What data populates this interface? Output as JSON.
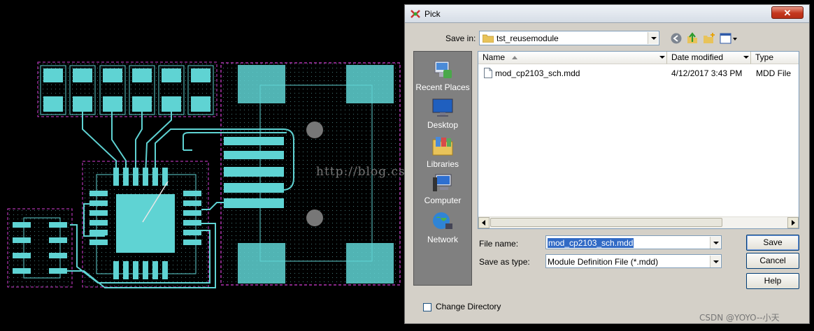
{
  "background": {
    "watermark": "http://blog.csdn.net/tgface",
    "csdn_mark": "CSDN @YOYO--小天",
    "board_color": "#5fd3d3",
    "outline_color": "#d63fd6"
  },
  "dialog": {
    "title": "Pick",
    "close_icon": "close-icon",
    "save_in_label": "Save in:",
    "save_in_value": "tst_reusemodule",
    "places": [
      {
        "label": "Recent Places",
        "icon": "recent-places-icon"
      },
      {
        "label": "Desktop",
        "icon": "desktop-icon"
      },
      {
        "label": "Libraries",
        "icon": "libraries-icon"
      },
      {
        "label": "Computer",
        "icon": "computer-icon"
      },
      {
        "label": "Network",
        "icon": "network-icon"
      }
    ],
    "columns": [
      "Name",
      "Date modified",
      "Type"
    ],
    "files": [
      {
        "name": "mod_cp2103_sch.mdd",
        "date": "4/12/2017 3:43 PM",
        "type": "MDD File"
      }
    ],
    "file_name_label": "File name:",
    "file_name_value": "mod_cp2103_sch.mdd",
    "save_as_type_label": "Save as type:",
    "save_as_type_value": "Module Definition File (*.mdd)",
    "save_button": "Save",
    "cancel_button": "Cancel",
    "help_button": "Help",
    "change_directory_label": "Change Directory",
    "accent_color": "#316ac5"
  }
}
